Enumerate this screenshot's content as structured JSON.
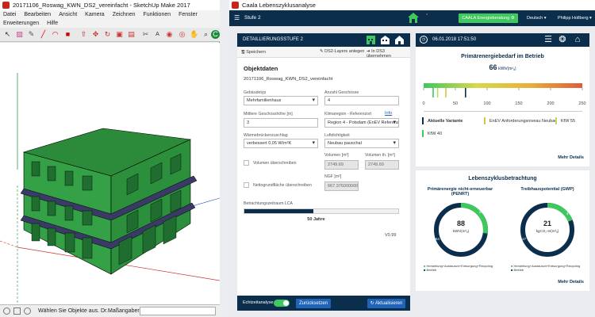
{
  "sketchup": {
    "title": "20171106_Roswag_KWN_DS2_vereinfacht - SketchUp Make 2017",
    "menu": [
      "Datei",
      "Bearbeiten",
      "Ansicht",
      "Kamera",
      "Zeichnen",
      "Funktionen",
      "Fenster",
      "Erweiterungen",
      "Hilfe"
    ],
    "status_text": "Wählen Sie Objekte aus. Dr...",
    "measure_label": "Maßangaben"
  },
  "caala": {
    "title": "Caala Lebenszyklusanalyse",
    "nav_stage": "Stufe 2",
    "energy_button": "CAALA Energieberatung",
    "language": "Deutsch",
    "user": "Philipp Hollberg",
    "left_panel": {
      "header": "DETAILLIERUNGSSTUFE 2",
      "save_label": "Speichern",
      "layers_label": "DS2-Layers anlegen",
      "transfer_label": "In DS3 übernehmen",
      "section_title": "Objektdaten",
      "project_name": "20171106_Roswag_KWN_DS2_vereinfacht",
      "building_type_label": "Gebäudetyp",
      "building_type_value": "Mehrfamilienhaus",
      "storeys_label": "Anzahl Geschosse",
      "storeys_value": "4",
      "height_label": "Mittlere Geschosshöhe [m]",
      "height_value": "3",
      "climate_label": "Klimaregion - Referenzort",
      "climate_info": "Info",
      "climate_value": "Region 4 - Potsdam (EnEV Referenz",
      "thermal_bridge_label": "Wärmebrückenzuschlag",
      "thermal_bridge_value": "verbessert 0,05 W/m²K",
      "airtight_label": "Luftdichtigkeit",
      "airtight_value": "Neubau pauschal",
      "volume_override_label": "Volumen überschreiben",
      "volume_label": "Volumen [m³]",
      "volume_value": "2749.69",
      "volume_th_label": "Volumen th. [m³]",
      "volume_th_value": "2749.69",
      "ngf_label": "NGF [m²]",
      "ngf_value": "667.376000000",
      "ngf_override_label": "Nettogrundfläche überschreiben",
      "lca_label": "Betrachtungszeitraum LCA",
      "lca_value": "50 Jahre",
      "lca_fraction": 0.45,
      "version": "V0.99",
      "realtime_label": "Echtzeitanalyse",
      "reset_label": "Zurücksetzen",
      "refresh_label": "Aktualisieren"
    },
    "right_panel": {
      "datetime": "06.01.2018 17:51:50",
      "primary_title": "Primärenergiebedarf im Betrieb",
      "primary_value": "66",
      "primary_unit": "kWh/(m²ₐ)",
      "scale_ticks": [
        "0",
        "50",
        "100",
        "150",
        "200",
        "250"
      ],
      "markers": [
        {
          "label": "Aktuelle Variante",
          "value": 66,
          "color": "#0b2e4d"
        },
        {
          "label": "EnEV Anforderungsniveau Neubau",
          "value": 35,
          "color": "#d9c24a"
        },
        {
          "label": "KfW 55",
          "value": 22,
          "color": "#b9dc5e"
        },
        {
          "label": "KfW 40",
          "value": 15,
          "color": "#3fc85e"
        }
      ],
      "more_label": "Mehr Details",
      "lifecycle_title": "Lebenszyklusbetrachtung",
      "penrt_title": "Primärenergie nicht-erneuerbar (PENRT)",
      "penrt_value": "88",
      "penrt_unit": "kWh/(m²ₐ)",
      "penrt_green_pct": "24",
      "penrt_dark_pct": "64",
      "gwp_title": "Treibhauspotential (GWP)",
      "gwp_value": "21",
      "gwp_unit": "kgCO₂-e/(m²ₐ)",
      "gwp_green_pct": "4",
      "gwp_dark_pct": "17",
      "donut_legend_1": "Herstellung+Austausch+Entsorgung+Recycling",
      "donut_legend_2": "Betrieb",
      "more_label_2": "Mehr Details"
    },
    "colors": {
      "navy": "#0b2e4d",
      "green": "#3fc85e",
      "blue_button": "#1f64b8"
    }
  }
}
